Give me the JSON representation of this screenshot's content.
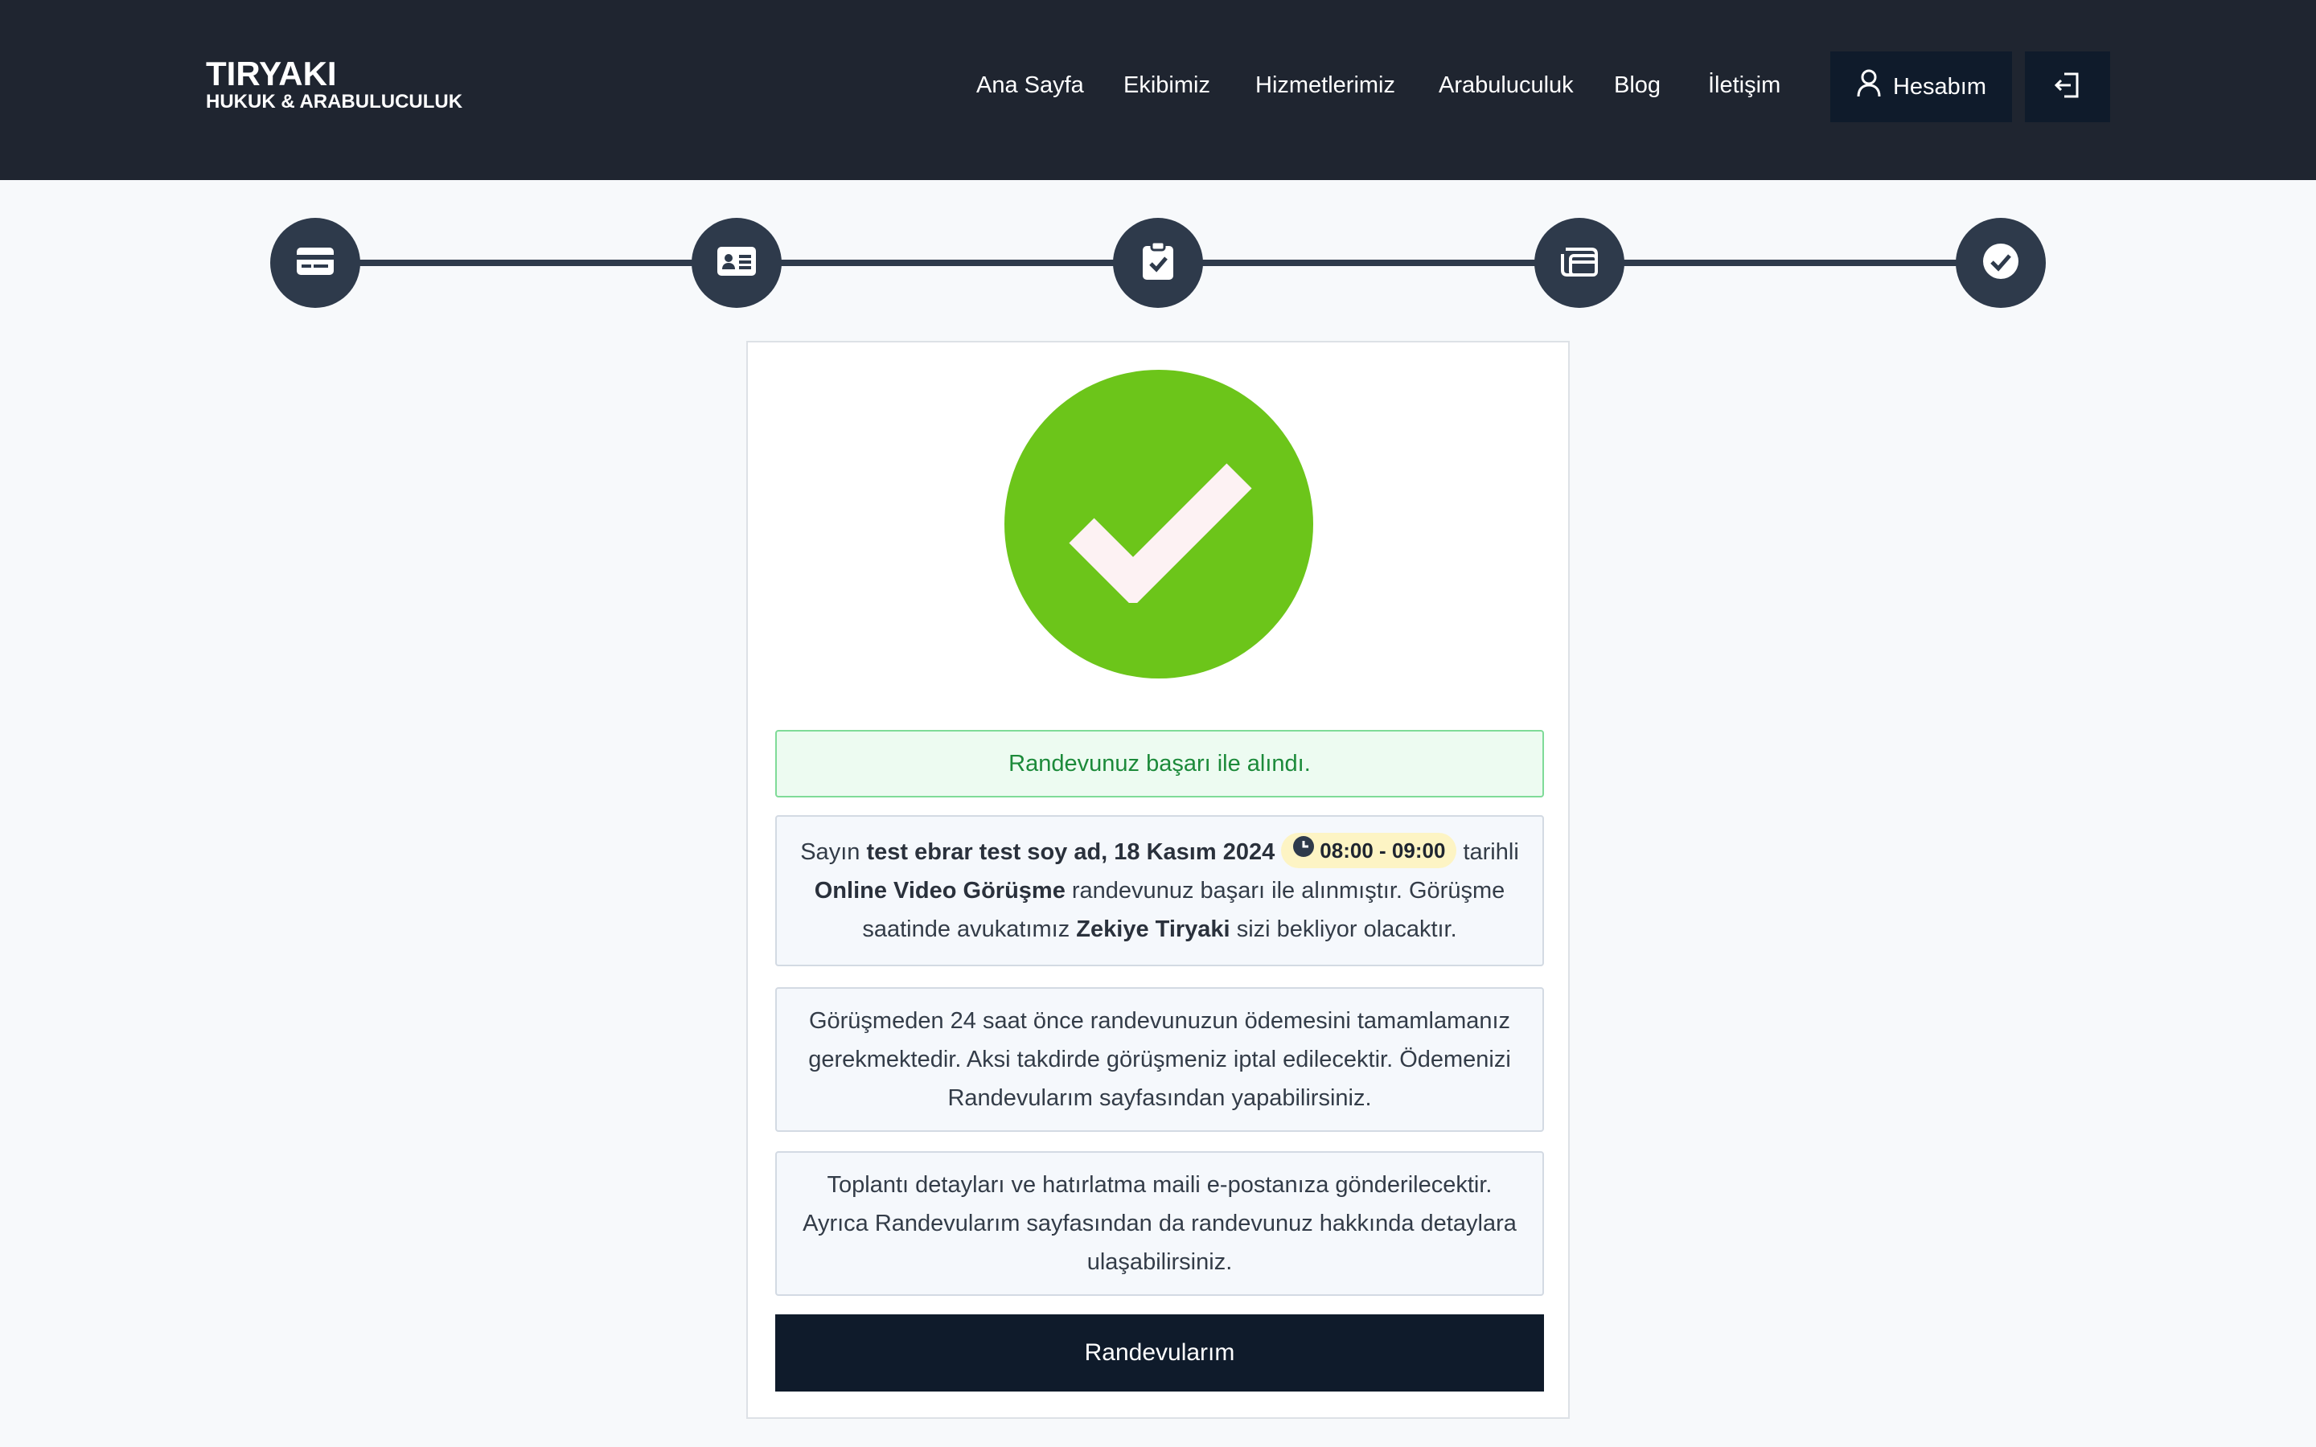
{
  "brand": {
    "name": "TIRYAKI",
    "tagline": "HUKUK & ARABULUCULUK"
  },
  "nav": {
    "items": [
      {
        "label": "Ana Sayfa"
      },
      {
        "label": "Ekibimiz"
      },
      {
        "label": "Hizmetlerimiz"
      },
      {
        "label": "Arabuluculuk"
      },
      {
        "label": "Blog"
      },
      {
        "label": "İletişim"
      }
    ],
    "account_label": "Hesabım",
    "account_icon": "user-icon",
    "logout_icon": "logout-icon"
  },
  "stepper": {
    "steps": [
      {
        "icon": "credit-card-icon"
      },
      {
        "icon": "id-card-icon"
      },
      {
        "icon": "clipboard-check-icon"
      },
      {
        "icon": "payment-card-icon"
      },
      {
        "icon": "check-circle-icon"
      }
    ],
    "color": "#2e3a4b"
  },
  "confirmation": {
    "success_icon": "checkmark-icon",
    "success_color": "#6cc51a",
    "alert": "Randevunuz başarı ile alındı.",
    "details": {
      "prefix": "Sayın",
      "name_date": "test ebrar test soy ad, 18 Kasım 2024",
      "time": "08:00 - 09:00",
      "after_time": "tarihli",
      "meeting_type": "Online Video Görüşme",
      "middle": "randevunuz başarı ile alınmıştır. Görüşme saatinde avukatımız",
      "lawyer": "Zekiye Tiryaki",
      "suffix": "sizi bekliyor olacaktır."
    },
    "payment_notice": "Görüşmeden 24 saat önce randevunuzun ödemesini tamamlamanız gerekmektedir. Aksi takdirde görüşmeniz iptal edilecektir. Ödemenizi Randevularım sayfasından yapabilirsiniz.",
    "email_notice": "Toplantı detayları ve hatırlatma maili e-postanıza gönderilecektir. Ayrıca Randevularım sayfasından da randevunuz hakkında detaylara ulaşabilirsiniz.",
    "button_label": "Randevularım"
  }
}
